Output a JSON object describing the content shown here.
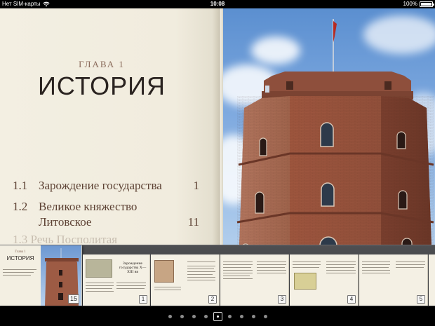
{
  "status_bar": {
    "carrier": "Нет SIM-карты",
    "time": "10:08",
    "battery": "100%",
    "battery_level": 1.0
  },
  "book": {
    "chapter_label": "ГЛАВА 1",
    "chapter_title": "ИСТОРИЯ",
    "toc": [
      {
        "num": "1.1",
        "title": "Зарождение государства",
        "page": "1"
      },
      {
        "num": "1.2",
        "title": "Великое княжество Литовское",
        "page": "11"
      }
    ],
    "toc_faded_text": "1.3  Речь Посполитая"
  },
  "filmstrip": {
    "selected_thumb": {
      "caption": "Глава 1",
      "title": "ИСТОРИЯ",
      "page": "15"
    },
    "thumbs": [
      {
        "page": "1",
        "title": "Зарождение государства X—XIII вв"
      },
      {
        "page": "2"
      },
      {
        "page": "3"
      },
      {
        "page": "4"
      },
      {
        "page": "5"
      }
    ]
  },
  "page_indicator": {
    "count": 9,
    "current": 4
  },
  "colors": {
    "paper": "#f3efe2",
    "toc_text": "#5d4234",
    "chapter_label": "#8a6a5a",
    "brick": "#9d5b44"
  }
}
